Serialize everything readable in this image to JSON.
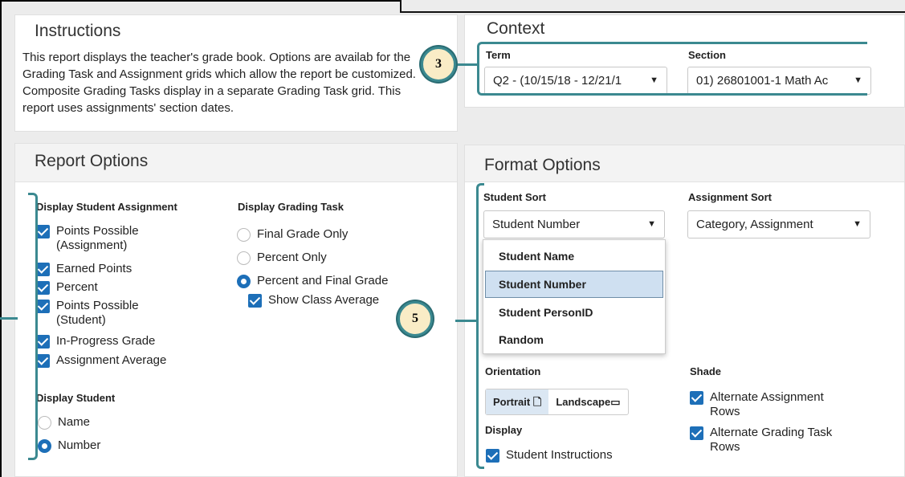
{
  "instructions": {
    "title": "Instructions",
    "body": "This report displays the teacher's grade book. Options are availab for the Grading Task and Assignment grids which allow the report be customized. Composite Grading Tasks display in a separate Grading Task grid. This report uses assignments' section dates."
  },
  "context": {
    "title": "Context",
    "term_label": "Term",
    "term_value": "Q2 - (10/15/18 - 12/21/1",
    "section_label": "Section",
    "section_value": "01) 26801001-1 Math Ac"
  },
  "report_options": {
    "title": "Report Options",
    "display_student_assignment": "Display Student Assignment",
    "assignment_items": [
      {
        "label": "Points Possible (Assignment)",
        "checked": true
      },
      {
        "label": "Earned Points",
        "checked": true
      },
      {
        "label": "Percent",
        "checked": true
      },
      {
        "label": "Points Possible (Student)",
        "checked": true
      },
      {
        "label": "In-Progress Grade",
        "checked": true
      },
      {
        "label": "Assignment Average",
        "checked": true
      }
    ],
    "display_grading_task": "Display Grading Task",
    "grading_items": [
      {
        "label": "Final Grade Only",
        "selected": false
      },
      {
        "label": "Percent Only",
        "selected": false
      },
      {
        "label": "Percent and Final Grade",
        "selected": true
      }
    ],
    "show_class_average": "Show Class Average",
    "display_student": "Display Student",
    "student_items": [
      {
        "label": "Name",
        "selected": false
      },
      {
        "label": "Number",
        "selected": true
      }
    ]
  },
  "format_options": {
    "title": "Format Options",
    "student_sort_label": "Student Sort",
    "student_sort_value": "Student Number",
    "student_sort_options": [
      "Student Name",
      "Student Number",
      "Student PersonID",
      "Random"
    ],
    "assignment_sort_label": "Assignment Sort",
    "assignment_sort_value": "Category, Assignment",
    "orientation_label": "Orientation",
    "portrait": "Portrait",
    "landscape": "Landscape",
    "display_label": "Display",
    "student_instructions": "Student Instructions",
    "shade_label": "Shade",
    "alternate_assignment_rows": "Alternate Assignment Rows",
    "alternate_grading_task_rows": "Alternate Grading Task Rows"
  },
  "callouts": {
    "three": "3",
    "five": "5"
  },
  "colors": {
    "accent": "#1d6fb8",
    "callout_teal": "#3b8990",
    "callout_fill": "#f9ecc6"
  }
}
